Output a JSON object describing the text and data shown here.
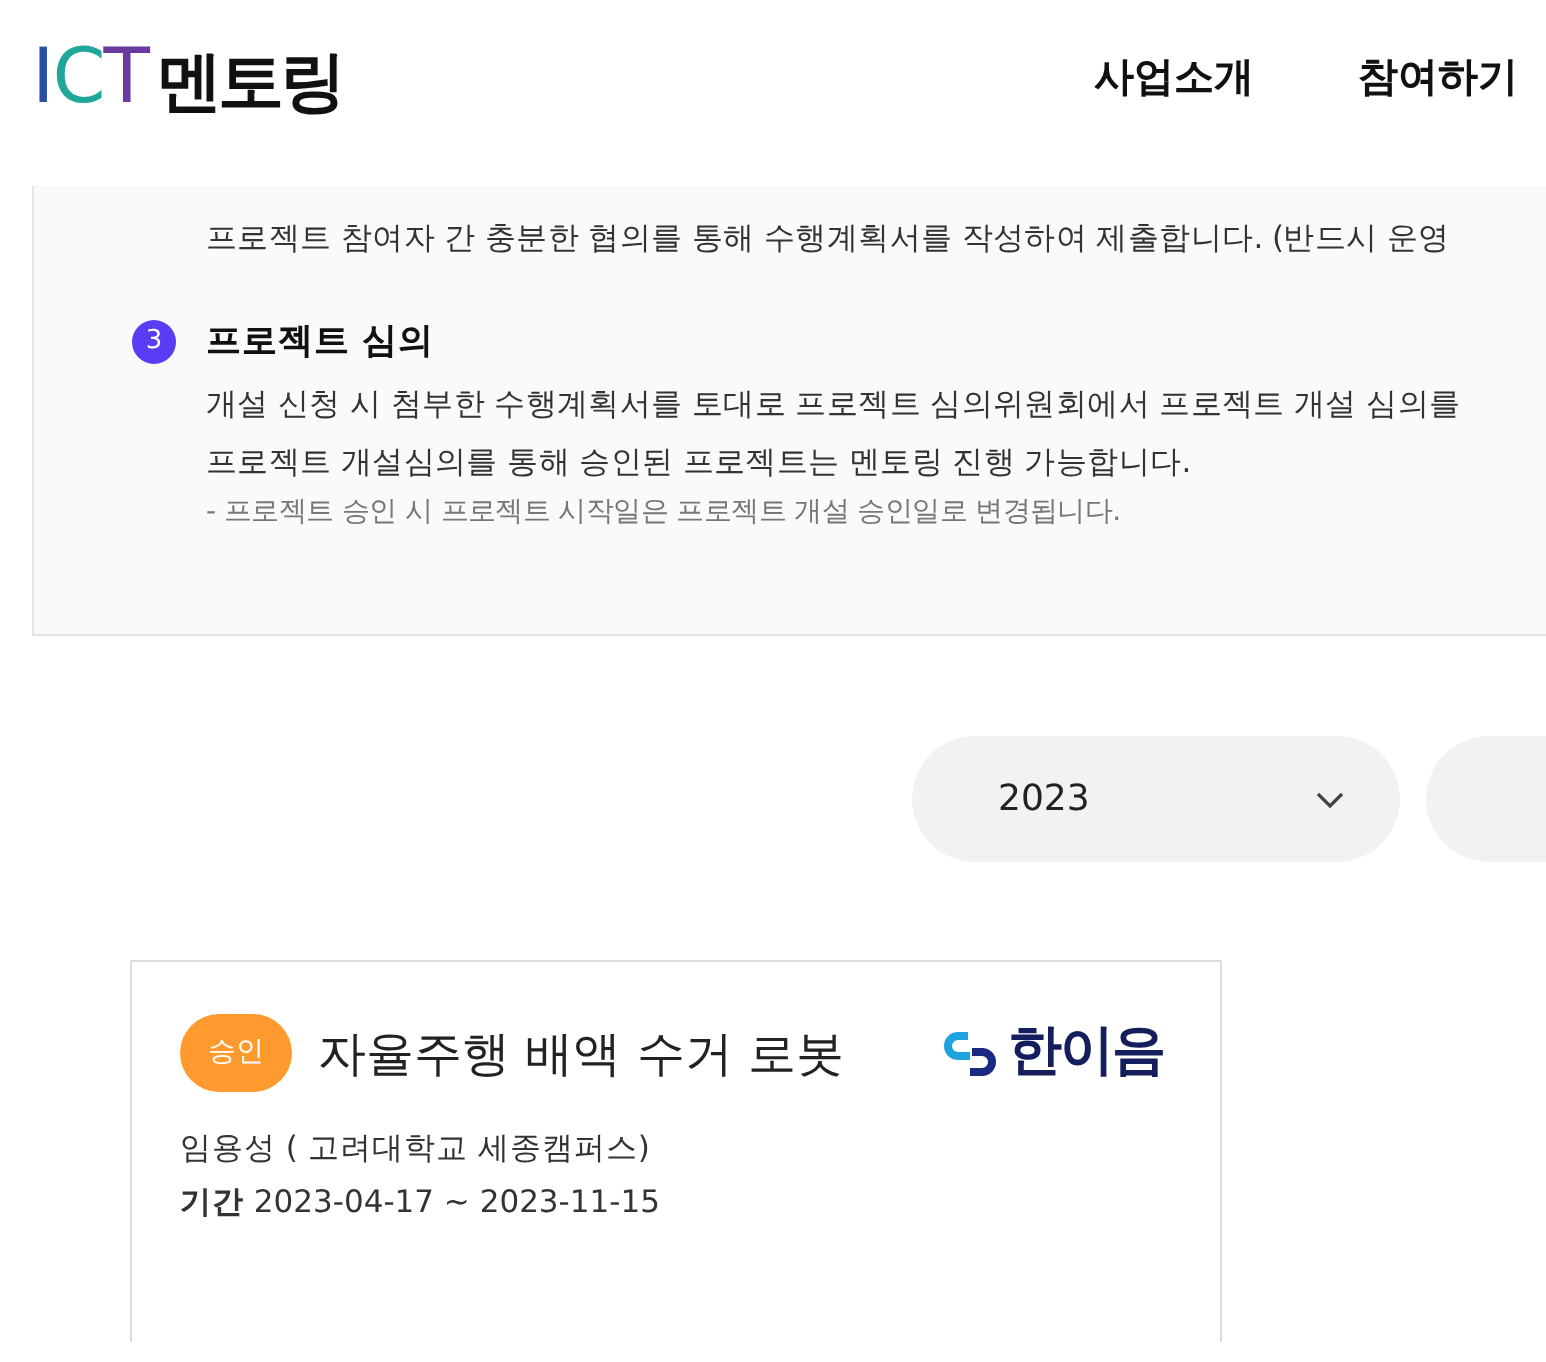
{
  "header": {
    "logo_letters": [
      {
        "text": "I",
        "color": "#2b4fa8"
      },
      {
        "text": "C",
        "color": "#1fa89a"
      },
      {
        "text": "T",
        "color": "#6b3aa0"
      }
    ],
    "logo_word": "멘토링",
    "nav": [
      {
        "label": "사업소개"
      },
      {
        "label": "참여하기"
      }
    ]
  },
  "process_panel": {
    "intro_line": "프로젝트 참여자 간 충분한 협의를 통해 수행계획서를 작성하여 제출합니다. (반드시 운영",
    "steps": [
      {
        "number": "3",
        "title": "프로젝트 심의",
        "lines": [
          "개설 신청 시 첨부한 수행계획서를 토대로 프로젝트 심의위원회에서 프로젝트 개설 심의를",
          "프로젝트 개설심의를 통해 승인된 프로젝트는 멘토링 진행 가능합니다."
        ],
        "note": "- 프로젝트 승인 시 프로젝트 시작일은 프로젝트 개설 승인일로 변경됩니다."
      }
    ]
  },
  "year_filter": {
    "value": "2023"
  },
  "projects": [
    {
      "status": "승인",
      "color": "#ff9a2e",
      "title": "자율주행 배액 수거 로봇",
      "partner_logo": "한이음",
      "mentor": "임용성 ( 고려대학교 세종캠퍼스)",
      "period_label": "기간",
      "period": "2023-04-17 ~ 2023-11-15"
    }
  ]
}
